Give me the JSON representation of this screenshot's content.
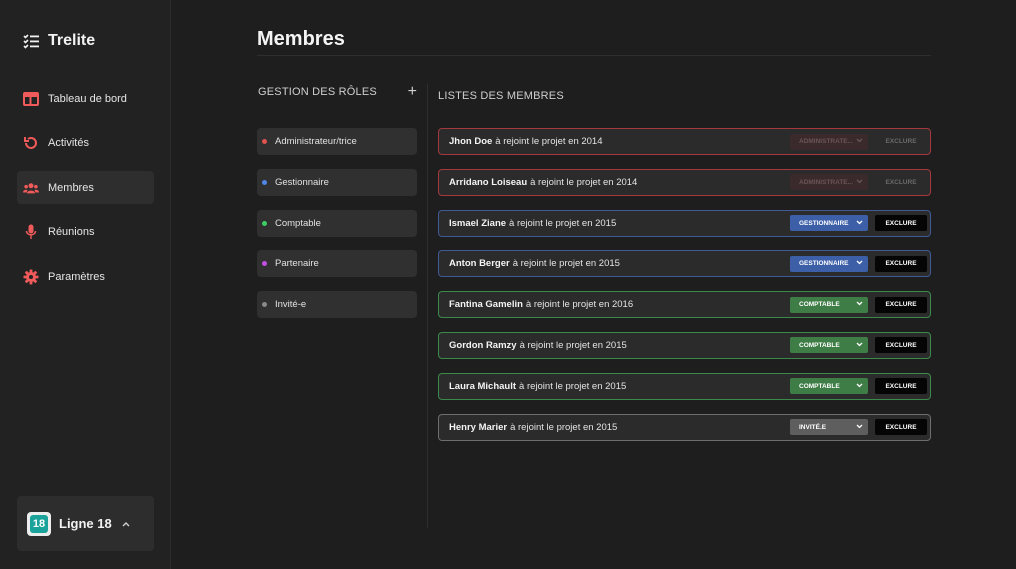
{
  "app": {
    "name": "Trelite"
  },
  "nav": [
    {
      "label": "Tableau de bord",
      "icon": "dashboard-icon",
      "active": false
    },
    {
      "label": "Activités",
      "icon": "history-icon",
      "active": false
    },
    {
      "label": "Membres",
      "icon": "users-icon",
      "active": true
    },
    {
      "label": "Réunions",
      "icon": "microphone-icon",
      "active": false
    },
    {
      "label": "Paramètres",
      "icon": "gear-icon",
      "active": false
    }
  ],
  "project": {
    "badge": "18",
    "name": "Ligne 18"
  },
  "page": {
    "title": "Membres"
  },
  "roles_section": {
    "title": "GESTION DES RÔLES",
    "add_label": "+"
  },
  "members_section": {
    "title": "LISTES DES MEMBRES"
  },
  "roles": [
    {
      "label": "Administrateur/trice",
      "color": "#e0524f"
    },
    {
      "label": "Gestionnaire",
      "color": "#4f86e8"
    },
    {
      "label": "Comptable",
      "color": "#3ccf63"
    },
    {
      "label": "Partenaire",
      "color": "#c24fe0"
    },
    {
      "label": "Invité-e",
      "color": "#8a8a8a"
    }
  ],
  "members": [
    {
      "name": "Jhon Doe",
      "joined": "à rejoint le projet en 2014",
      "role": "ADMINISTRATE...",
      "kind": "admin",
      "border": "#a3393c",
      "select_bg": "#3a2a2b",
      "exclude": "EXCLURE"
    },
    {
      "name": "Arridano Loiseau",
      "joined": "à rejoint le projet en 2014",
      "role": "ADMINISTRATE...",
      "kind": "admin",
      "border": "#a3393c",
      "select_bg": "#3a2a2b",
      "exclude": "EXCLURE"
    },
    {
      "name": "Ismael Ziane",
      "joined": "à rejoint le projet en 2015",
      "role": "GESTIONNAIRE",
      "kind": "manager",
      "border": "#3f5a95",
      "select_bg": "#3c5fa8",
      "exclude": "EXCLURE"
    },
    {
      "name": "Anton Berger",
      "joined": "à rejoint le projet en 2015",
      "role": "GESTIONNAIRE",
      "kind": "manager",
      "border": "#3f5a95",
      "select_bg": "#3c5fa8",
      "exclude": "EXCLURE"
    },
    {
      "name": "Fantina Gamelin",
      "joined": "à rejoint le projet en 2016",
      "role": "COMPTABLE",
      "kind": "accountant",
      "border": "#3b8a4c",
      "select_bg": "#3f7d47",
      "exclude": "EXCLURE"
    },
    {
      "name": "Gordon Ramzy",
      "joined": "à rejoint le projet en 2015",
      "role": "COMPTABLE",
      "kind": "accountant",
      "border": "#3b8a4c",
      "select_bg": "#3f7d47",
      "exclude": "EXCLURE"
    },
    {
      "name": "Laura Michault",
      "joined": "à rejoint le projet en 2015",
      "role": "COMPTABLE",
      "kind": "accountant",
      "border": "#3b8a4c",
      "select_bg": "#3f7d47",
      "exclude": "EXCLURE"
    },
    {
      "name": "Henry Marier",
      "joined": "à rejoint le projet en 2015",
      "role": "INVITÉ.E",
      "kind": "guest",
      "border": "#6e6e6e",
      "select_bg": "#5e5e5e",
      "exclude": "EXCLURE"
    }
  ]
}
